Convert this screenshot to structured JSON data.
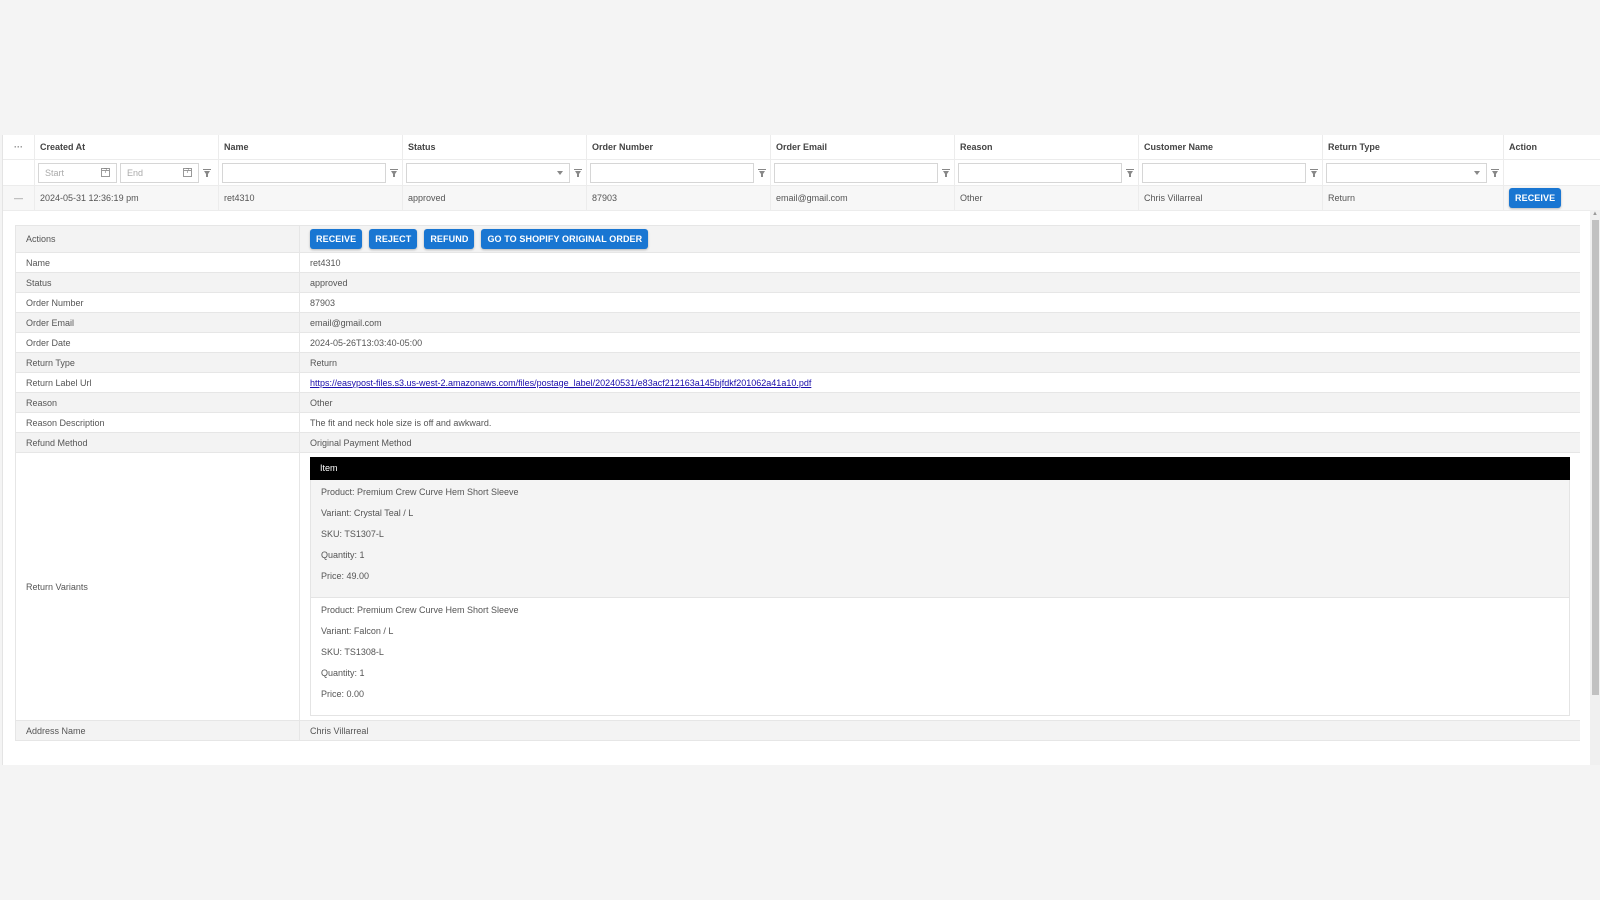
{
  "grid": {
    "columns": [
      {
        "key": "menu",
        "label": "···"
      },
      {
        "key": "created_at",
        "label": "Created At"
      },
      {
        "key": "name",
        "label": "Name"
      },
      {
        "key": "status",
        "label": "Status"
      },
      {
        "key": "order_number",
        "label": "Order Number"
      },
      {
        "key": "order_email",
        "label": "Order Email"
      },
      {
        "key": "reason",
        "label": "Reason"
      },
      {
        "key": "customer_name",
        "label": "Customer Name"
      },
      {
        "key": "return_type",
        "label": "Return Type"
      },
      {
        "key": "action",
        "label": "Action"
      }
    ],
    "filters": {
      "start_placeholder": "Start",
      "end_placeholder": "End",
      "name": "",
      "status": "",
      "order_number": "",
      "order_email": "",
      "reason": "",
      "customer_name": "",
      "return_type": ""
    },
    "row": {
      "collapse": "—",
      "created_at": "2024-05-31 12:36:19 pm",
      "name": "ret4310",
      "status": "approved",
      "order_number": "87903",
      "order_email": "email@gmail.com",
      "reason": "Other",
      "customer_name": "Chris Villarreal",
      "return_type": "Return",
      "action_label": "RECEIVE"
    }
  },
  "detail": {
    "actions_label": "Actions",
    "buttons": {
      "receive": "RECEIVE",
      "reject": "REJECT",
      "refund": "REFUND",
      "shopify": "GO TO SHOPIFY ORIGINAL ORDER"
    },
    "fields": [
      {
        "label": "Name",
        "value": "ret4310"
      },
      {
        "label": "Status",
        "value": "approved"
      },
      {
        "label": "Order Number",
        "value": "87903"
      },
      {
        "label": "Order Email",
        "value": "email@gmail.com"
      },
      {
        "label": "Order Date",
        "value": "2024-05-26T13:03:40-05:00"
      },
      {
        "label": "Return Type",
        "value": "Return"
      },
      {
        "label": "Return Label Url",
        "value": "https://easypost-files.s3.us-west-2.amazonaws.com/files/postage_label/20240531/e83acf212163a145bjfdkf201062a41a10.pdf"
      },
      {
        "label": "Reason",
        "value": "Other"
      },
      {
        "label": "Reason Description",
        "value": "The fit and neck hole size is off and awkward."
      },
      {
        "label": "Refund Method",
        "value": "Original Payment Method"
      }
    ],
    "return_variants_label": "Return Variants",
    "items_header": "Item",
    "items": [
      {
        "product": "Product: Premium Crew Curve Hem Short Sleeve",
        "variant": "Variant: Crystal Teal / L",
        "sku": "SKU: TS1307-L",
        "quantity": "Quantity: 1",
        "price": "Price: 49.00"
      },
      {
        "product": "Product: Premium Crew Curve Hem Short Sleeve",
        "variant": "Variant: Falcon / L",
        "sku": "SKU: TS1308-L",
        "quantity": "Quantity: 1",
        "price": "Price: 0.00"
      }
    ],
    "address_name_label": "Address Name",
    "address_name": "Chris Villarreal"
  },
  "colors": {
    "primary": "#1976d2",
    "link": "#1a0dab",
    "item_header": "#000000"
  }
}
